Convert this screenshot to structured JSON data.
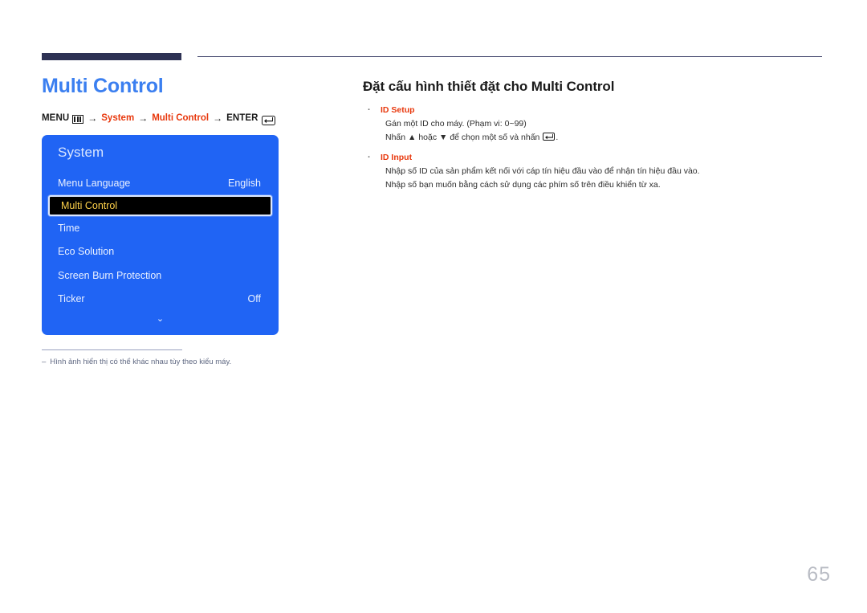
{
  "document": {
    "page_number": "65"
  },
  "left": {
    "chapter_title": "Multi Control",
    "breadcrumb": {
      "menu_label": "MENU",
      "menu_icon": "menu-bars-icon",
      "arrow": "→",
      "step1": "System",
      "step2": "Multi Control",
      "enter_label": "ENTER",
      "enter_icon": "enter-return-icon"
    },
    "osd": {
      "title": "System",
      "rows": [
        {
          "label": "Menu Language",
          "value": "English",
          "selected": false
        },
        {
          "label": "Multi Control",
          "value": "",
          "selected": true
        },
        {
          "label": "Time",
          "value": "",
          "selected": false
        },
        {
          "label": "Eco Solution",
          "value": "",
          "selected": false
        },
        {
          "label": "Screen Burn Protection",
          "value": "",
          "selected": false
        },
        {
          "label": "Ticker",
          "value": "Off",
          "selected": false
        }
      ],
      "scroll_indicator": "⌄",
      "colors": {
        "panel_background": "#2064f4",
        "selected_background": "#000000",
        "selected_text": "#ffd24a",
        "row_text": "#e9f0ff"
      }
    },
    "footnote": {
      "dash": "–",
      "text": "Hình ảnh hiển thị có thể khác nhau tùy theo kiểu máy."
    }
  },
  "right": {
    "section_title": "Đặt cấu hình thiết đặt cho Multi Control",
    "bullets": [
      {
        "dot": "·",
        "heading": "ID Setup",
        "lines": [
          "Gán một ID cho máy. (Phạm vi: 0~99)",
          "Nhấn ▲ hoặc ▼ để chọn một số và nhấn"
        ],
        "line_suffix": "."
      },
      {
        "dot": "·",
        "heading": "ID Input",
        "lines": [
          "Nhập số ID của sản phẩm kết nối với cáp tín hiệu đầu vào để nhận tín hiệu đầu vào.",
          "Nhập số bạn muốn bằng cách sử dụng các phím số trên điều khiển từ xa."
        ]
      }
    ],
    "accent_color": "#e8380d"
  }
}
